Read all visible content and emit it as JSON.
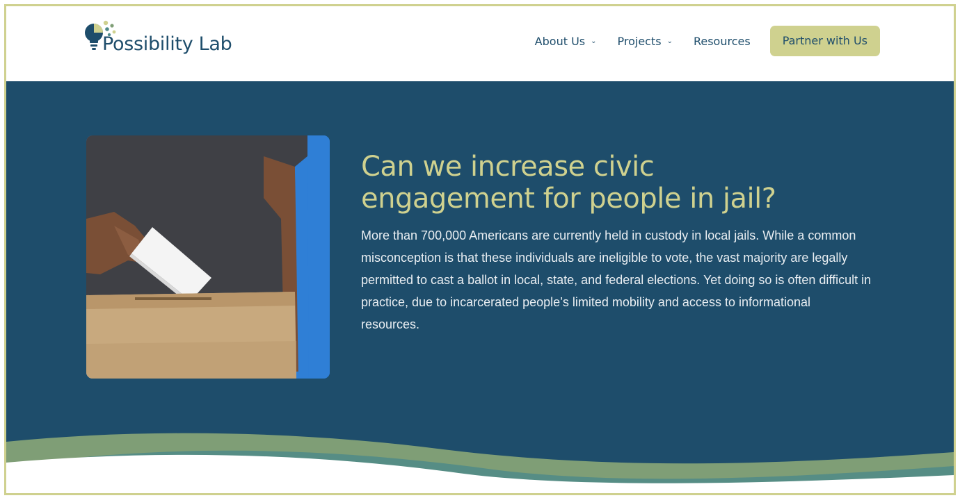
{
  "brand": {
    "name": "Possibility Lab"
  },
  "nav": {
    "items": [
      {
        "label": "About Us",
        "has_dropdown": true
      },
      {
        "label": "Projects",
        "has_dropdown": true
      },
      {
        "label": "Resources",
        "has_dropdown": false
      }
    ],
    "cta_label": "Partner with Us"
  },
  "hero": {
    "title_line1": "Can we increase civic",
    "title_line2": "engagement for people in jail?",
    "body": "More than 700,000 Americans are currently held in custody in local jails. While a common misconception is that these individuals are ineligible to vote, the vast majority are legally permitted to cast a ballot in local, state, and federal elections. Yet doing so is often difficult in practice, due to incarcerated people’s limited mobility and access to informational resources."
  },
  "colors": {
    "navy": "#1e4d6b",
    "accent": "#cfd18f",
    "wave_green": "#7f9e76",
    "wave_teal": "#4f8a88"
  },
  "icons": {
    "logo": "lightbulb-dots-logo",
    "dropdown": "chevron-down-icon"
  }
}
